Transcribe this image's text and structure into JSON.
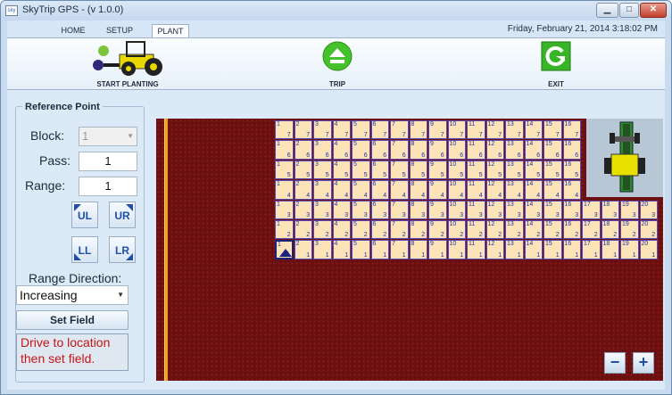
{
  "window": {
    "title": "SkyTrip GPS - (v 1.0.0)",
    "icon_text": "sky"
  },
  "tabs": [
    {
      "label": "HOME"
    },
    {
      "label": "SETUP"
    },
    {
      "label": "PLANT",
      "active": true
    }
  ],
  "datetime": "Friday, February 21, 2014 3:18:02 PM",
  "ribbon": {
    "start_planting": "START PLANTING",
    "trip": "TRIP",
    "exit": "EXIT"
  },
  "reference_point": {
    "title": "Reference Point",
    "block_label": "Block:",
    "block_value": "1",
    "pass_label": "Pass:",
    "pass_value": "1",
    "range_label": "Range:",
    "range_value": "1",
    "corner_buttons": [
      "UL",
      "UR",
      "LL",
      "LR"
    ],
    "range_direction_label": "Range Direction:",
    "range_direction_value": "Increasing",
    "set_field_label": "Set Field",
    "message": "Drive to location then set field."
  },
  "map": {
    "zoom_out": "−",
    "zoom_in": "+"
  },
  "colors": {
    "field_bg": "#6a1010",
    "plot_cell": "#fde3b8",
    "boundary": "#f59c16",
    "accent_blue": "#1f4fa6",
    "message_red": "#c41414"
  }
}
